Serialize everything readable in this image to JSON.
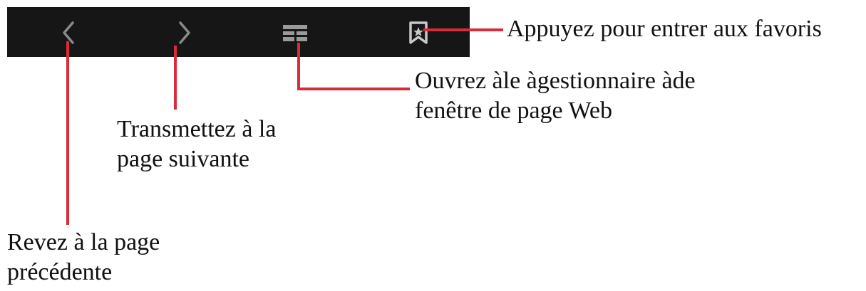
{
  "toolbar": {
    "background": "#161616",
    "icon_color": "#8a8a8a",
    "buttons": [
      {
        "id": "back",
        "icon": "chevron-left-icon"
      },
      {
        "id": "forward",
        "icon": "chevron-right-icon"
      },
      {
        "id": "window-manager",
        "icon": "windows-icon"
      },
      {
        "id": "bookmark",
        "icon": "bookmark-icon"
      }
    ]
  },
  "callout_color": "#d92b3a",
  "callouts": {
    "favorites": "Appuyez pour entrer aux favoris",
    "window_manager": "Ouvrez àle àgestionnaire àde\nfenêtre de page Web",
    "forward": "Transmettez à la\npage suivante",
    "back": "Revez à la page\nprécédente"
  }
}
